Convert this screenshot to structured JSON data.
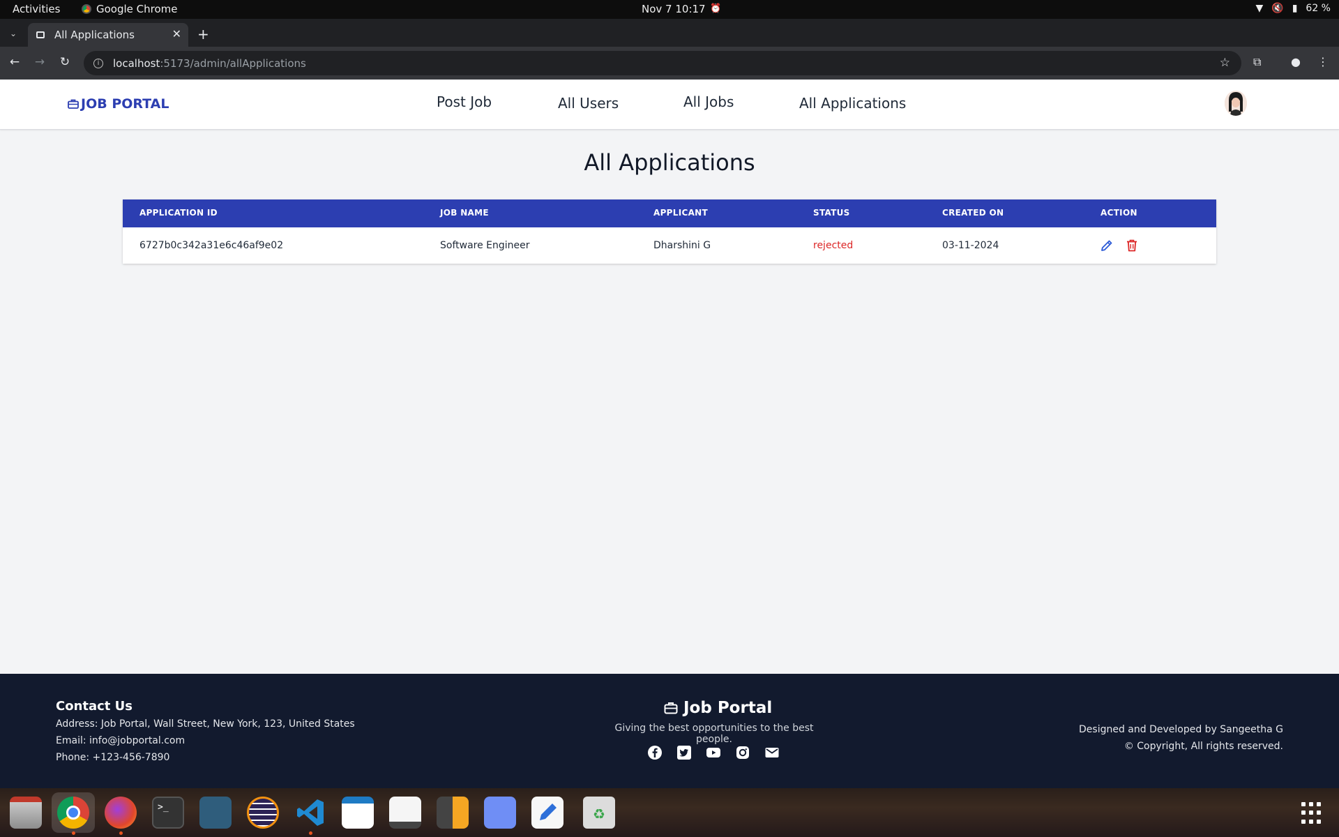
{
  "system": {
    "activities": "Activities",
    "app_name": "Google Chrome",
    "datetime": "Nov 7  10:17",
    "battery": "62 %"
  },
  "browser": {
    "tab_title": "All Applications",
    "url_host": "localhost",
    "url_path": ":5173/admin/allApplications"
  },
  "navbar": {
    "brand": "JOB PORTAL",
    "links": [
      "Post Job",
      "All Users",
      "All Jobs",
      "All Applications"
    ]
  },
  "main": {
    "title": "All Applications",
    "table": {
      "headers": [
        "APPLICATION ID",
        "JOB NAME",
        "APPLICANT",
        "STATUS",
        "CREATED ON",
        "ACTION"
      ],
      "rows": [
        {
          "application_id": "6727b0c342a31e6c46af9e02",
          "job_name": "Software Engineer",
          "applicant": "Dharshini G",
          "status": "rejected",
          "created_on": "03-11-2024"
        }
      ]
    }
  },
  "footer": {
    "contact_title": "Contact Us",
    "address": "Address: Job Portal, Wall Street, New York, 123, United States",
    "email": "Email: info@jobportal.com",
    "phone": "Phone: +123-456-7890",
    "brand": "Job Portal",
    "tagline": "Giving the best opportunities to the best people.",
    "credit": "Designed and Developed by Sangeetha G",
    "copyright": "© Copyright, All rights reserved.",
    "social_icons": [
      "facebook-icon",
      "twitter-icon",
      "youtube-icon",
      "instagram-icon",
      "mail-icon"
    ]
  },
  "colors": {
    "primary": "#2c3eb1",
    "status_rejected": "#dc2626",
    "footer_bg": "#121a2e",
    "page_bg": "#f3f4f6"
  },
  "dock": {
    "apps": [
      "files-icon",
      "chrome-icon",
      "firefox-icon",
      "terminal-icon",
      "mysql-workbench-icon",
      "eclipse-icon",
      "vscode-icon",
      "libreoffice-impress-icon",
      "document-viewer-icon",
      "calculator-icon",
      "tasks-icon",
      "text-editor-icon",
      "trash-icon"
    ]
  }
}
